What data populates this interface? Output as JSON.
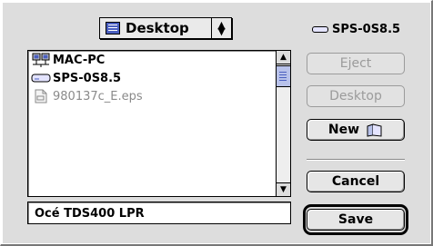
{
  "location_popup": {
    "label": "Desktop",
    "icon": "desktop-icon"
  },
  "files": [
    {
      "name": "MAC-PC",
      "icon": "network-computer-icon",
      "dimmed": false
    },
    {
      "name": "SPS-0S8.5",
      "icon": "hard-disk-icon",
      "dimmed": false
    },
    {
      "name": "980137c_E.eps",
      "icon": "document-icon",
      "dimmed": true
    }
  ],
  "volume": {
    "name": "SPS-0S8.5",
    "icon": "hard-disk-icon"
  },
  "buttons": {
    "eject": {
      "label": "Eject",
      "enabled": false
    },
    "desktop": {
      "label": "Desktop",
      "enabled": false
    },
    "new": {
      "label": "New",
      "icon": "new-folder-icon",
      "enabled": true
    },
    "cancel": {
      "label": "Cancel",
      "enabled": true
    },
    "save": {
      "label": "Save",
      "enabled": true,
      "default": true
    }
  },
  "name_field": {
    "value": "Océ TDS400 LPR"
  },
  "colors": {
    "background": "#dddddd",
    "scroll_thumb": "#b8c2ea",
    "accent": "#4a5fc0",
    "disabled_text": "#9b9b9b"
  }
}
